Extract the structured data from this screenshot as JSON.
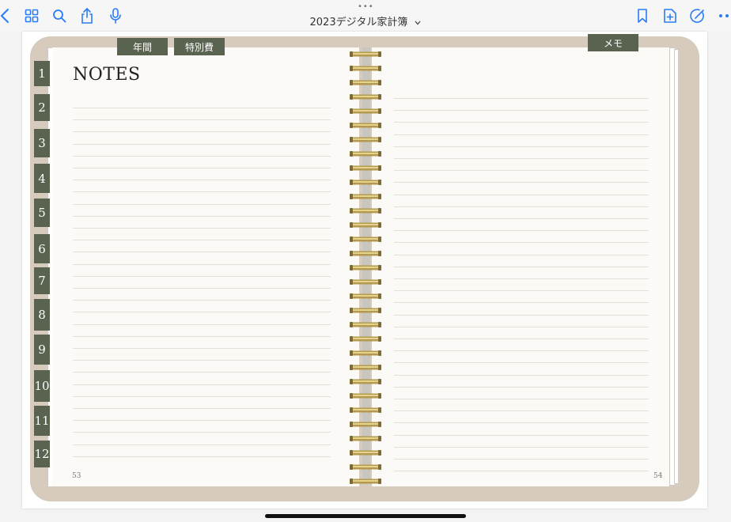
{
  "toolbar": {
    "doc_title": "2023デジタル家計簿",
    "icons_left": [
      "back-icon",
      "grid-icon",
      "search-icon",
      "share-icon",
      "microphone-icon"
    ],
    "icons_right": [
      "bookmark-icon",
      "add-page-icon",
      "markup-icon",
      "more-icon"
    ]
  },
  "notebook": {
    "left_page": {
      "title": "NOTES",
      "page_number": "53"
    },
    "right_page": {
      "page_number": "54"
    },
    "top_tabs": [
      {
        "label": "年間"
      },
      {
        "label": "特別費"
      },
      {
        "label": "メモ"
      }
    ],
    "month_tabs": [
      "1",
      "2",
      "3",
      "4",
      "5",
      "6",
      "7",
      "8",
      "9",
      "10",
      "11",
      "12"
    ]
  },
  "colors": {
    "tab_green": "#5a6250",
    "cover": "#d6cbbd",
    "paper": "#fbfaf6",
    "ring_gold": "#b49a4e"
  }
}
